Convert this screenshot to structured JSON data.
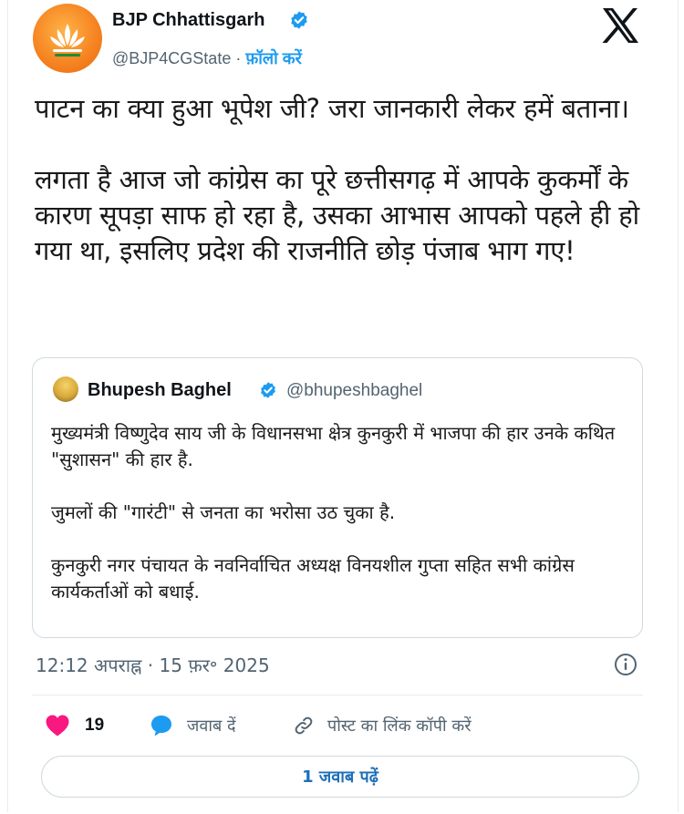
{
  "author": {
    "name": "BJP Chhattisgarh",
    "handle": "@BJP4CGState",
    "separator": " · ",
    "follow_label": "फ़ॉलो करें",
    "avatar_icon": "bjp-lotus-logo",
    "verified_icon": "verified-badge-icon"
  },
  "platform_icon": "x-logo-icon",
  "tweet": {
    "text": "पाटन का क्या हुआ भूपेश जी? जरा जानकारी लेकर हमें बताना।\n\nलगता है आज जो कांग्रेस का पूरे छत्तीसगढ़ में आपके कुकर्मों के कारण सूपड़ा साफ हो रहा है, उसका आभास आपको पहले ही हो गया था, इसलिए प्रदेश की राजनीति छोड़ पंजाब भाग गए!"
  },
  "quoted_tweet": {
    "name": "Bhupesh Baghel",
    "handle": "@bhupeshbaghel",
    "text": "मुख्यमंत्री विष्णुदेव साय जी के विधानसभा क्षेत्र कुनकुरी में भाजपा की हार उनके कथित \"सुशासन\" की हार है.\n\nजुमलों की \"गारंटी\" से जनता का भरोसा उठ चुका है.\n\nकुनकुरी नगर पंचायत के नवनिर्वाचित अध्यक्ष विनयशील गुप्ता सहित सभी कांग्रेस कार्यकर्ताओं को बधाई."
  },
  "timestamp": "12:12 अपराह्न · 15 फ़र॰ 2025",
  "actions": {
    "like_count": "19",
    "reply_label": "जवाब दें",
    "copy_link_label": "पोस्ट का लिंक कॉपी करें"
  },
  "read_replies_label": "1 जवाब पढ़ें",
  "colors": {
    "accent": "#1d9bf0",
    "like": "#f91880",
    "reply": "#1d9bf0",
    "secondary_text": "#536471",
    "border": "#cfd9de"
  }
}
